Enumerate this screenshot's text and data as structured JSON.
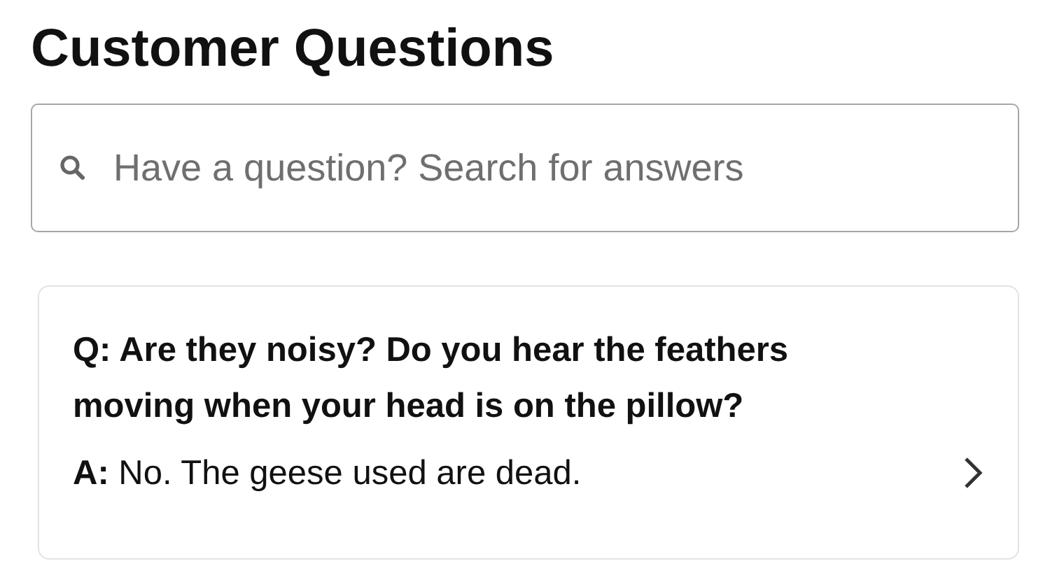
{
  "title": "Customer Questions",
  "search": {
    "placeholder": "Have a question? Search for answers"
  },
  "questions": [
    {
      "question": "Q: Are they noisy? Do you hear the feathers moving when your head is on the pillow?",
      "answer": "**A:** No. The geese used are dead."
    }
  ]
}
